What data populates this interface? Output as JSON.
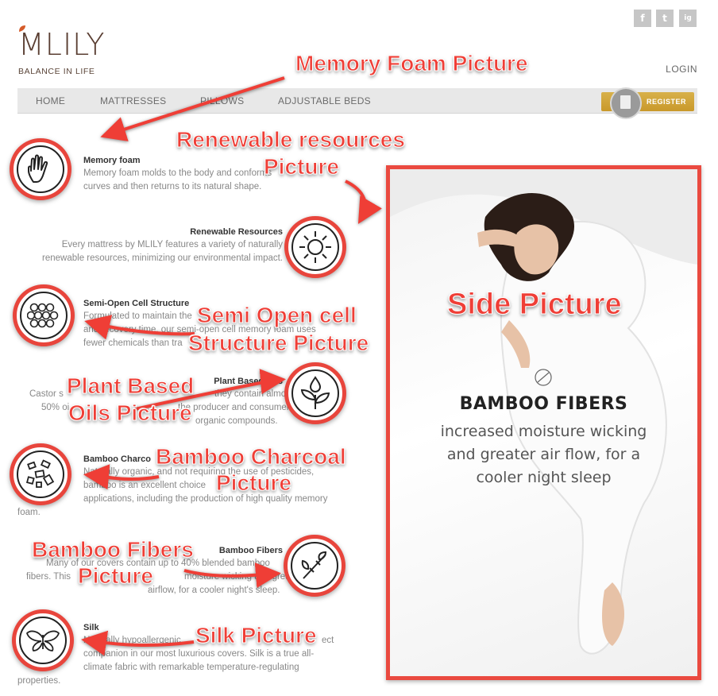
{
  "header": {
    "social": [
      "f",
      "t",
      "ig"
    ],
    "logo_word": "MLILY",
    "logo_tagline": "BALANCE IN LIFE",
    "login": "LOGIN"
  },
  "nav": {
    "items": [
      "HOME",
      "MATTRESSES",
      "PILLOWS",
      "ADJUSTABLE BEDS"
    ],
    "register": "REGISTER"
  },
  "features": [
    {
      "title": "Memory foam",
      "lines": [
        "Memory foam molds to the body and conforms",
        "curves and then returns to its natural shape."
      ],
      "icon": "hand-icon"
    },
    {
      "title": "Renewable Resources",
      "lines": [
        "Every mattress by MLILY features a variety of naturally",
        "renewable resources, minimizing our environmental impact."
      ],
      "icon": "sun-icon"
    },
    {
      "title": "Semi-Open Cell Structure",
      "lines": [
        "Formulated to maintain the",
        "and recovery time, our semi-open cell memory foam uses",
        "fewer chemicals than tra"
      ],
      "icon": "cells-icon"
    },
    {
      "title": "Plant Based Oils",
      "lines": [
        "Castor s",
        "they contain almost",
        "50% oi",
        "the producer and consumer,",
        "organic compounds."
      ],
      "icon": "leaf-drop-icon"
    },
    {
      "title": "Bamboo Charco",
      "lines": [
        "Naturally organic, and not requiring the use of pesticides,",
        "bamboo is an excellent choice",
        "applications, including the production of high quality memory",
        "foam."
      ],
      "icon": "charcoal-icon"
    },
    {
      "title": "Bamboo Fibers",
      "lines": [
        "Many of our covers contain up to 40% blended bamboo",
        "fibers. This",
        "moisture wicking and greater",
        "airflow, for a cooler night's sleep."
      ],
      "icon": "bamboo-icon"
    },
    {
      "title": "Silk",
      "lines": [
        "Naturally hypoallergenic,",
        "ect",
        "companion in our most luxurious covers. Silk is a true all-",
        "climate fabric with remarkable temperature-regulating",
        "properties."
      ],
      "icon": "butterfly-icon"
    }
  ],
  "side_picture": {
    "title": "BAMBOO FIBERS",
    "desc_lines": [
      "increased moisture wicking",
      "and greater air flow, for a",
      "cooler night sleep"
    ]
  },
  "annotations": {
    "memory_foam": "Memory Foam Picture",
    "renewable_1": "Renewable resources",
    "renewable_2": "Picture",
    "semi_1": "Semi Open cell",
    "semi_2": "Structure Picture",
    "plant_1": "Plant Based",
    "plant_2": "Oils Picture",
    "charcoal_1": "Bamboo Charcoal",
    "charcoal_2": "Picture",
    "fibers_1": "Bamboo Fibers",
    "fibers_2": "Picture",
    "silk": "Silk Picture",
    "side": "Side Picture"
  },
  "colors": {
    "annotation": "#ef3e36",
    "register": "#c9992a",
    "brand": "#5a3e32"
  }
}
